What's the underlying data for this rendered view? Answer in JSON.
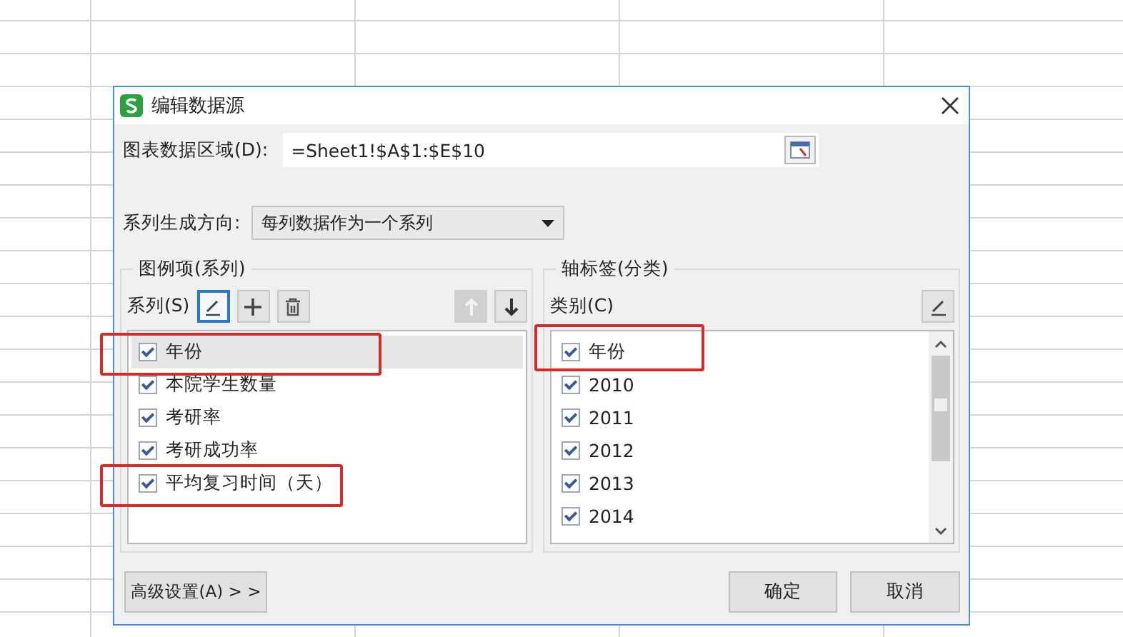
{
  "window": {
    "title": "编辑数据源"
  },
  "data_range": {
    "label": "图表数据区域(D):",
    "value": "=Sheet1!$A$1:$E$10"
  },
  "series_direction": {
    "label": "系列生成方向:",
    "value": "每列数据作为一个系列"
  },
  "legend_group": {
    "title": "图例项(系列)",
    "label": "系列(S)",
    "tools": [
      {
        "kind": "edit",
        "selected": true,
        "disabled": false
      },
      {
        "kind": "add",
        "selected": false,
        "disabled": false
      },
      {
        "kind": "delete",
        "selected": false,
        "disabled": false
      },
      {
        "kind": "up",
        "selected": false,
        "disabled": true
      },
      {
        "kind": "down",
        "selected": false,
        "disabled": false
      }
    ],
    "items": [
      {
        "label": "年份",
        "checked": true,
        "selected": true,
        "highlighted": true
      },
      {
        "label": "本院学生数量",
        "checked": true,
        "selected": false,
        "highlighted": false
      },
      {
        "label": "考研率",
        "checked": true,
        "selected": false,
        "highlighted": false
      },
      {
        "label": "考研成功率",
        "checked": true,
        "selected": false,
        "highlighted": false
      },
      {
        "label": "平均复习时间（天）",
        "checked": true,
        "selected": false,
        "highlighted": true
      }
    ]
  },
  "axis_group": {
    "title": "轴标签(分类)",
    "label": "类别(C)",
    "tools": [
      {
        "kind": "edit",
        "selected": false,
        "disabled": false
      }
    ],
    "items": [
      {
        "label": "年份",
        "checked": true,
        "selected": false,
        "highlighted": true
      },
      {
        "label": "2010",
        "checked": true,
        "selected": false,
        "highlighted": false
      },
      {
        "label": "2011",
        "checked": true,
        "selected": false,
        "highlighted": false
      },
      {
        "label": "2012",
        "checked": true,
        "selected": false,
        "highlighted": false
      },
      {
        "label": "2013",
        "checked": true,
        "selected": false,
        "highlighted": false
      },
      {
        "label": "2014",
        "checked": true,
        "selected": false,
        "highlighted": false
      }
    ]
  },
  "buttons": [
    {
      "label": "高级设置(A) > >"
    },
    {
      "label": "确定"
    },
    {
      "label": "取消"
    }
  ]
}
